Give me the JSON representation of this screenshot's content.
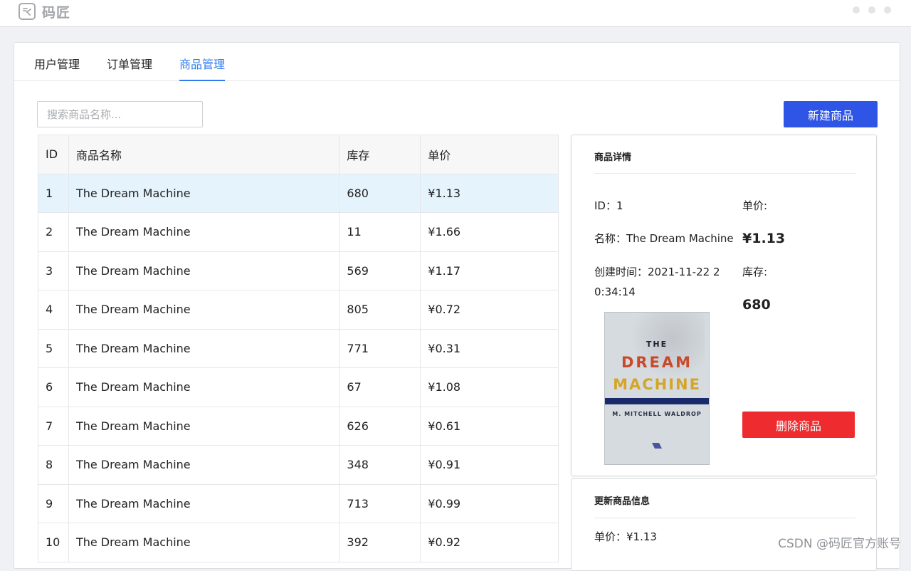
{
  "app": {
    "logo_text": "码匠"
  },
  "tabs": [
    {
      "label": "用户管理",
      "active": false
    },
    {
      "label": "订单管理",
      "active": false
    },
    {
      "label": "商品管理",
      "active": true
    }
  ],
  "toolbar": {
    "search_placeholder": "搜索商品名称...",
    "new_button": "新建商品"
  },
  "table": {
    "columns": [
      "ID",
      "商品名称",
      "库存",
      "单价"
    ],
    "selected_row": 0,
    "rows": [
      {
        "id": "1",
        "name": "The Dream Machine",
        "stock": "680",
        "price": "¥1.13"
      },
      {
        "id": "2",
        "name": "The Dream Machine",
        "stock": "11",
        "price": "¥1.66"
      },
      {
        "id": "3",
        "name": "The Dream Machine",
        "stock": "569",
        "price": "¥1.17"
      },
      {
        "id": "4",
        "name": "The Dream Machine",
        "stock": "805",
        "price": "¥0.72"
      },
      {
        "id": "5",
        "name": "The Dream Machine",
        "stock": "771",
        "price": "¥0.31"
      },
      {
        "id": "6",
        "name": "The Dream Machine",
        "stock": "67",
        "price": "¥1.08"
      },
      {
        "id": "7",
        "name": "The Dream Machine",
        "stock": "626",
        "price": "¥0.61"
      },
      {
        "id": "8",
        "name": "The Dream Machine",
        "stock": "348",
        "price": "¥0.91"
      },
      {
        "id": "9",
        "name": "The Dream Machine",
        "stock": "713",
        "price": "¥0.99"
      },
      {
        "id": "10",
        "name": "The Dream Machine",
        "stock": "392",
        "price": "¥0.92"
      }
    ]
  },
  "detail": {
    "title": "商品详情",
    "id_text": "ID：1",
    "name_text": "名称：The Dream Machine",
    "created_line1": "创建时间：2021-11-22 2",
    "created_line2": "0:34:14",
    "price_label": "单价:",
    "price_value": "¥1.13",
    "stock_label": "库存:",
    "stock_value": "680",
    "delete_button": "删除商品",
    "cover": {
      "the": "THE",
      "dream": "DREAM",
      "machine": "MACHINE",
      "author": "M. MITCHELL WALDROP"
    }
  },
  "update": {
    "title": "更新商品信息",
    "price_text": "单价：¥1.13"
  },
  "watermark": "CSDN @码匠官方账号",
  "colors": {
    "primary": "#2f55e6",
    "tab_active": "#2f7bf0",
    "danger": "#ee2b2e",
    "row_selected": "#e5f4fc"
  }
}
